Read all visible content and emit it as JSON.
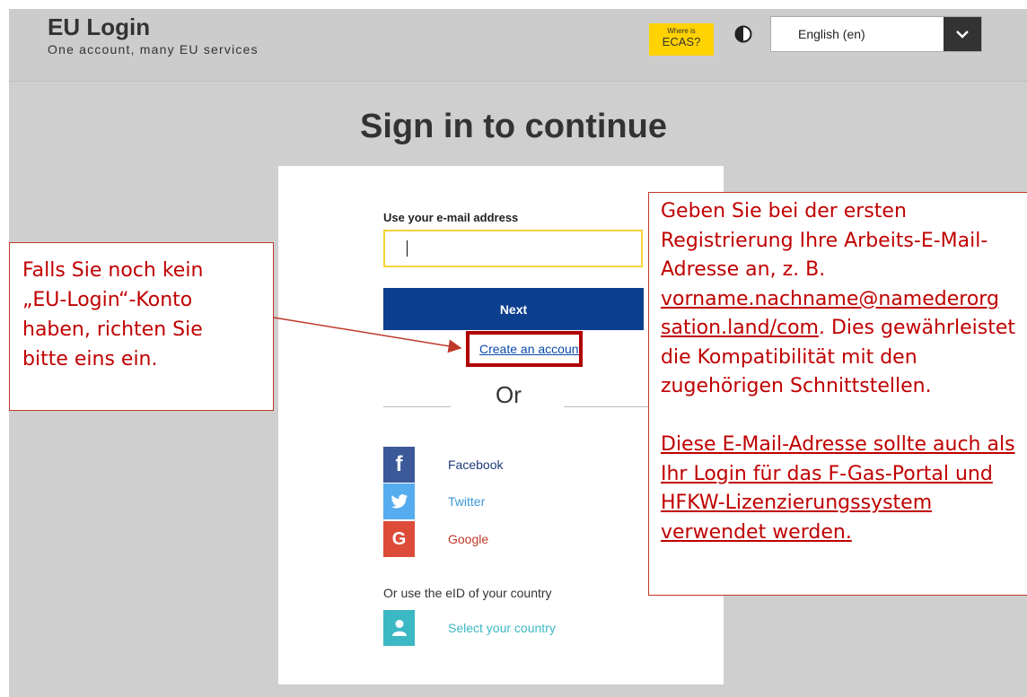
{
  "header": {
    "app_title": "EU Login",
    "app_subtitle": "One account, many EU services",
    "ecas_badge": {
      "line1": "Where is",
      "line2": "ECAS?",
      "color": "#ffd200"
    },
    "language": {
      "selected": "English (en)"
    }
  },
  "main": {
    "title": "Sign in to continue",
    "email_label": "Use your e-mail address",
    "email_value": "",
    "next_label": "Next",
    "create_account_label": "Create an account",
    "or_label": "Or",
    "social": [
      {
        "name": "Facebook",
        "icon": "facebook-icon",
        "color": "#3b5998",
        "label_color": "#1d3a7a"
      },
      {
        "name": "Twitter",
        "icon": "twitter-icon",
        "color": "#55acee",
        "label_color": "#3a9ad9"
      },
      {
        "name": "Google",
        "icon": "google-icon",
        "color": "#dd4b39",
        "label_color": "#c0392b"
      }
    ],
    "eid_label": "Or use the eID of your country",
    "country": {
      "label": "Select your country",
      "icon": "user-icon",
      "color": "#3cb8c4"
    }
  },
  "annotations": {
    "left_lines": [
      "Falls Sie noch kein",
      "„EU-Login“-Konto",
      "haben, richten Sie",
      "bitte eins ein."
    ],
    "right_lines": [
      "Geben Sie bei der ersten",
      "Registrierung Ihre Arbeits-E-Mail-",
      "Adresse an, z. B."
    ],
    "right_email_line1": "vorname.nachname@namederorg",
    "right_email_line2": "sation.land/com",
    "right_after_email": ". Dies gewährleistet",
    "right_lines2": [
      "die Kompatibilität mit den",
      "zugehörigen Schnittstellen."
    ],
    "right_underlined": [
      "Diese E-Mail-Adresse sollte auch als",
      "Ihr Login für das F-Gas-Portal und",
      "HFKW-Lizenzierungssystem",
      "verwendet werden."
    ]
  }
}
